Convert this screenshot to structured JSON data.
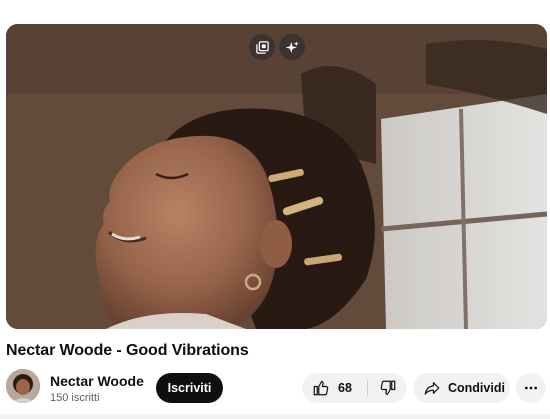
{
  "video": {
    "title": "Nectar Woode - Good Vibrations",
    "overlay_buttons": [
      {
        "icon": "miniplayer-icon"
      },
      {
        "icon": "sparkle-icon"
      }
    ]
  },
  "channel": {
    "name": "Nectar Woode",
    "subscribers": "150 iscritti",
    "subscribe_label": "Iscriviti"
  },
  "actions": {
    "like_count": "68",
    "like_icon": "thumbs-up-icon",
    "dislike_icon": "thumbs-down-icon",
    "share_label": "Condividi",
    "share_icon": "share-arrow-icon",
    "more_icon": "more-horizontal-icon"
  },
  "colors": {
    "subscribe_bg": "#0f0f0f",
    "pill_bg": "#f2f2f2",
    "secondary_text": "#606060"
  }
}
